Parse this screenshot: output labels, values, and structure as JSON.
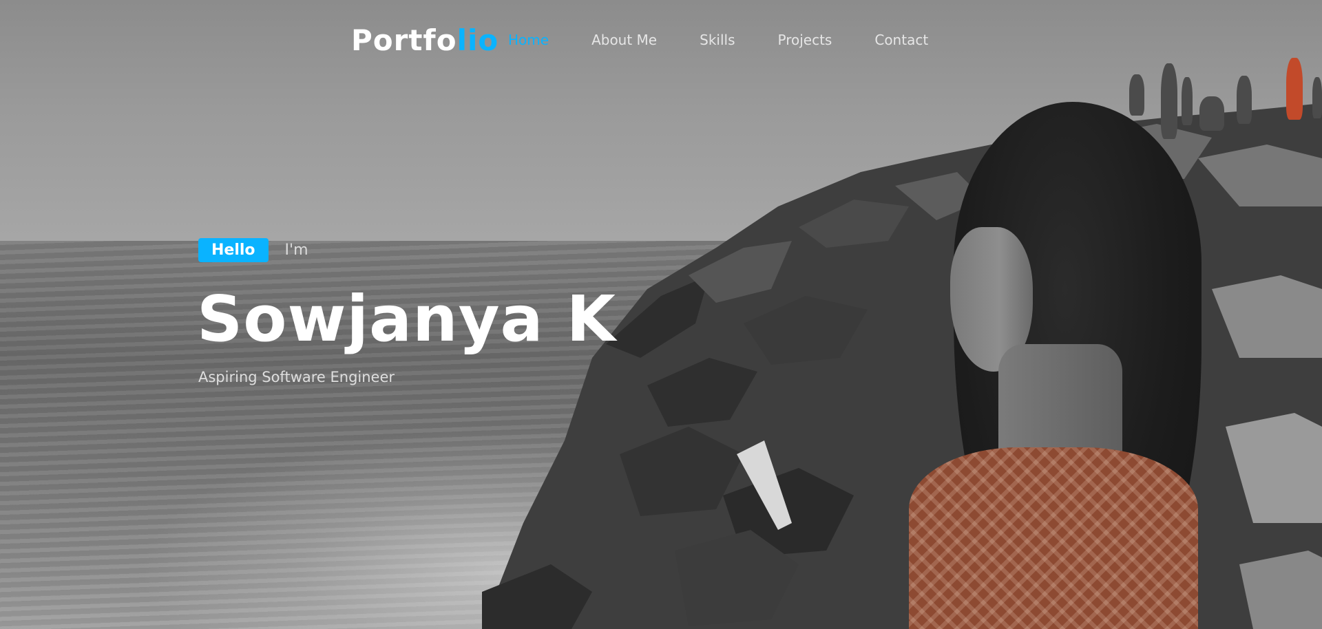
{
  "nav": {
    "logo_main": "Portfo",
    "logo_accent": "lio",
    "links": [
      "Home",
      "About Me",
      "Skills",
      "Projects",
      "Contact"
    ],
    "active": "Home"
  },
  "hero": {
    "greeting_badge": "Hello",
    "greeting_text": "I'm",
    "name": "Sowjanya K",
    "tagline": "Aspiring Software Engineer"
  },
  "colors": {
    "accent": "#0ab3ff",
    "text_primary": "#ffffff"
  }
}
